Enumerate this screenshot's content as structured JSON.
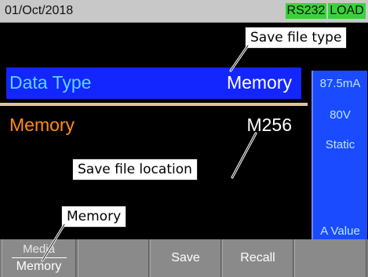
{
  "status_bar": {
    "date": "01/Oct/2018",
    "badges": [
      "RS232",
      "LOAD"
    ]
  },
  "callouts": {
    "save_file_type": "Save file type",
    "save_file_location": "Save file location",
    "memory": "Memory"
  },
  "settings": {
    "data_type": {
      "label": "Data Type",
      "value": "Memory"
    },
    "memory": {
      "label": "Memory",
      "value": "M256"
    }
  },
  "side_panel": {
    "current": "87.5mA",
    "voltage": "80V",
    "mode": "Static",
    "footer": "A Value"
  },
  "softkeys": {
    "media": {
      "top": "Media",
      "bottom": "Memory"
    },
    "blank1": "",
    "save": "Save",
    "recall": "Recall",
    "blank2": ""
  },
  "colors": {
    "status_bar": "#c8c8c8",
    "badge": "#39d339",
    "selected_row": "#1326ff",
    "label_cyan": "#5cd6ff",
    "label_orange": "#ff8c1a",
    "side_panel": "#1a4bff",
    "softkey": "#8a8a8a"
  }
}
